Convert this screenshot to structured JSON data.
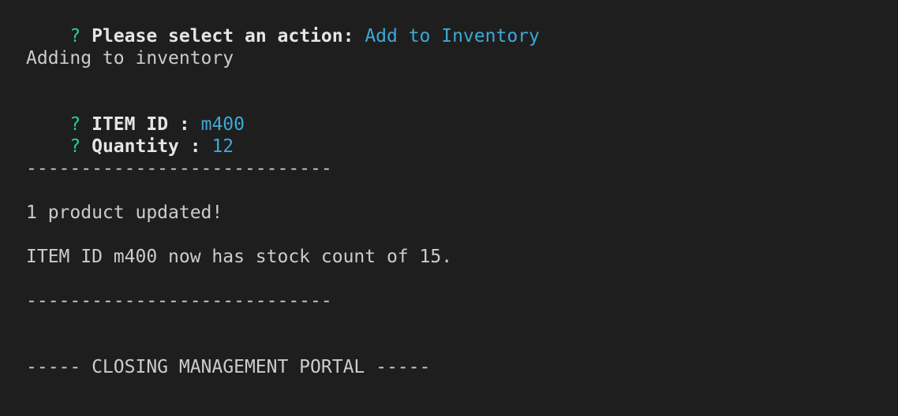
{
  "terminal": {
    "prompt_marker": "?",
    "prompt_action": {
      "label": "Please select an action:",
      "answer": "Add to Inventory"
    },
    "status_adding": "Adding to inventory",
    "prompt_item_id": {
      "label": "ITEM ID :",
      "answer": "m400"
    },
    "prompt_quantity": {
      "label": "Quantity :",
      "answer": "12"
    },
    "divider": "----------------------------",
    "result_message": "1 product updated!",
    "stock_message": "ITEM ID m400 now has stock count of 15.",
    "closing_banner": "----- CLOSING MANAGEMENT PORTAL -----"
  }
}
